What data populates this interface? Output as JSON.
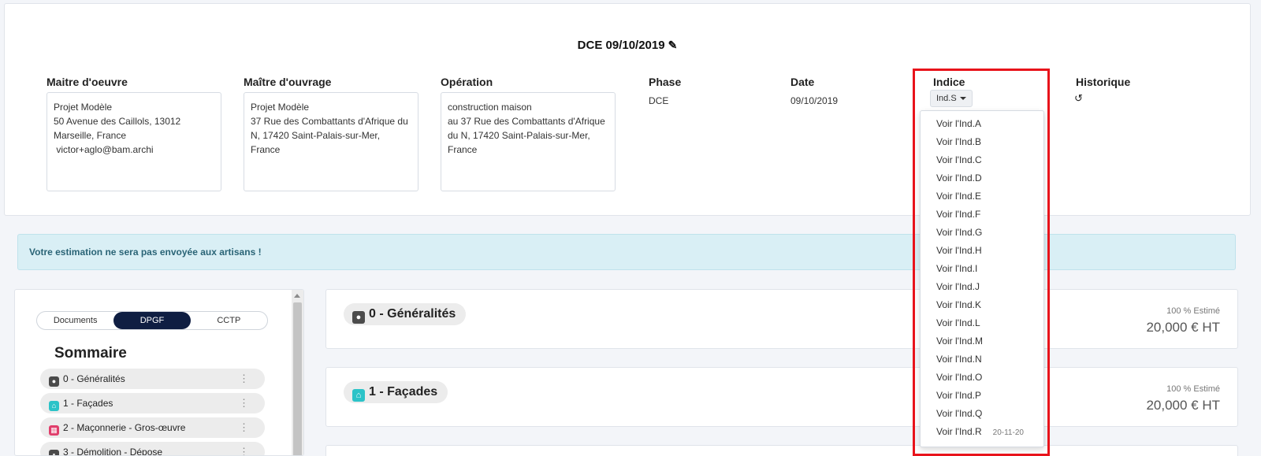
{
  "doc_title": "DCE 09/10/2019",
  "fields": {
    "maitre_oeuvre": {
      "label": "Maitre d'oeuvre",
      "lines": [
        "Projet Modèle",
        "50 Avenue des Caillols, 13012",
        "Marseille, France",
        " victor+aglo@bam.archi"
      ]
    },
    "maitre_ouvrage": {
      "label": "Maître d'ouvrage",
      "lines": [
        "Projet Modèle",
        "37 Rue des Combattants d'Afrique du",
        "N, 17420 Saint-Palais-sur-Mer,",
        "France"
      ]
    },
    "operation": {
      "label": "Opération",
      "lines": [
        "construction maison",
        "au 37 Rue des Combattants d'Afrique",
        "du N, 17420 Saint-Palais-sur-Mer,",
        "France"
      ]
    },
    "phase": {
      "label": "Phase",
      "value": "DCE"
    },
    "date": {
      "label": "Date",
      "value": "09/10/2019"
    },
    "indice": {
      "label": "Indice",
      "value": "Ind.S"
    },
    "historique": {
      "label": "Historique"
    }
  },
  "dropdown": {
    "items": [
      "Voir l'Ind.A",
      "Voir l'Ind.B",
      "Voir l'Ind.C",
      "Voir l'Ind.D",
      "Voir l'Ind.E",
      "Voir l'Ind.F",
      "Voir l'Ind.G",
      "Voir l'Ind.H",
      "Voir l'Ind.I",
      "Voir l'Ind.J",
      "Voir l'Ind.K",
      "Voir l'Ind.L",
      "Voir l'Ind.M",
      "Voir l'Ind.N",
      "Voir l'Ind.O",
      "Voir l'Ind.P",
      "Voir l'Ind.Q",
      "Voir l'Ind.R"
    ],
    "last_item_date": "20-11-20"
  },
  "alert": "Votre estimation ne sera pas envoyée aux artisans !",
  "tabs": [
    "Documents",
    "DPGF",
    "CCTP"
  ],
  "sommaire": {
    "title": "Sommaire",
    "items": [
      "0 - Généralités",
      "1 - Façades",
      "2 - Maçonnerie - Gros-œuvre",
      "3 - Démolition - Dépose"
    ]
  },
  "sections": [
    {
      "title": "0 - Généralités",
      "estimate": "100 % Estimé",
      "amount": "20,000 € HT"
    },
    {
      "title": "1 - Façades",
      "estimate": "100 % Estimé",
      "amount": "20,000 € HT"
    }
  ],
  "colors": {
    "accent": "#0f1e42",
    "highlight": "#e8131b",
    "alert_bg": "#d9eff5",
    "facades_icon": "#2bc3c8",
    "maconnerie_icon": "#e03e6b",
    "generalites_icon": "#4b4b4b"
  }
}
